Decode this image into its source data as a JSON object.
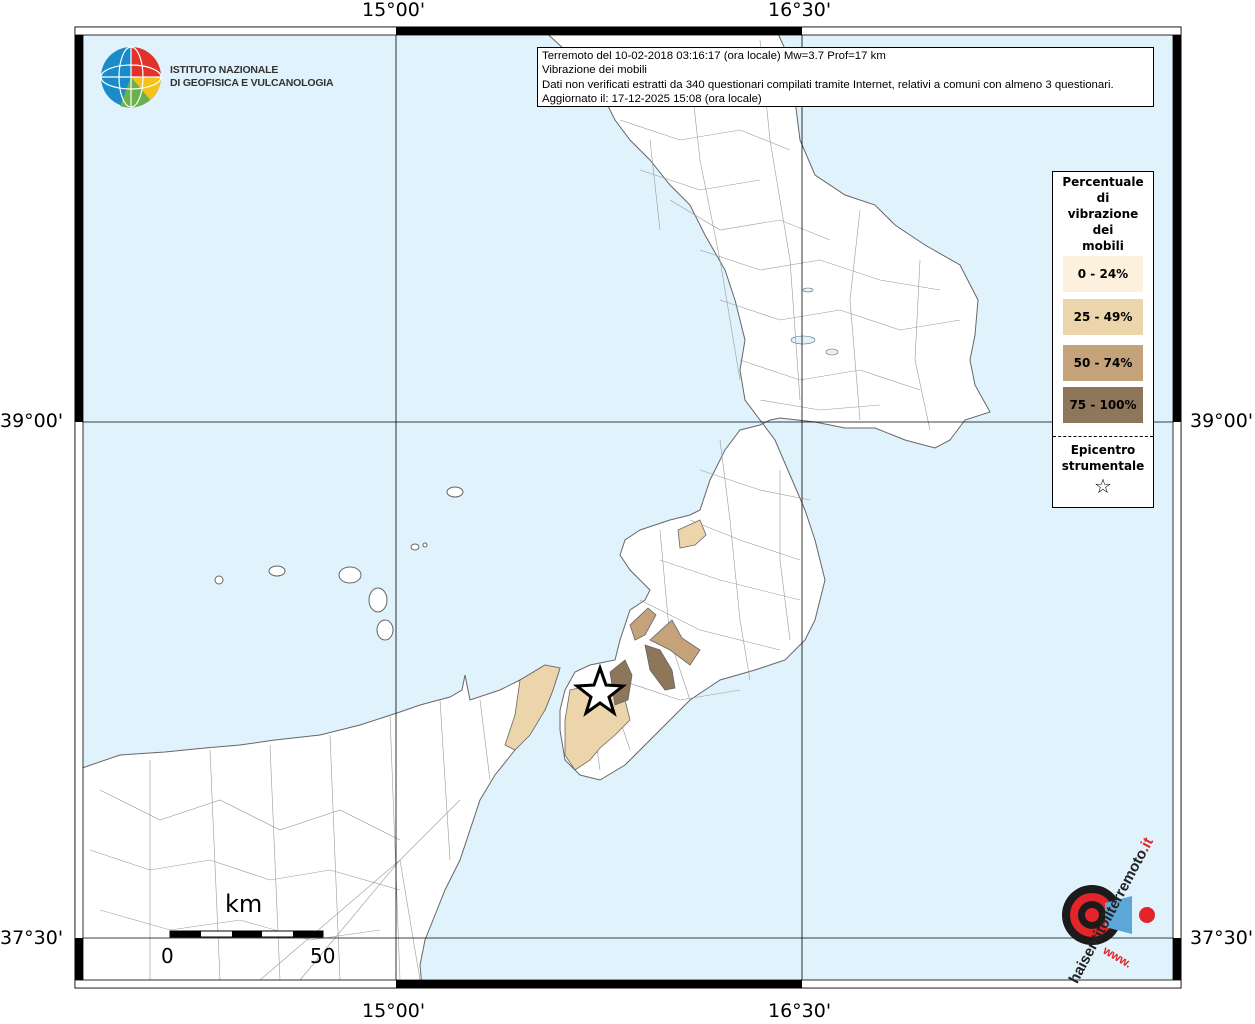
{
  "map": {
    "axes": {
      "lon_top_left": "15°00'",
      "lon_top_right": "16°30'",
      "lon_bottom_left": "15°00'",
      "lon_bottom_right": "16°30'",
      "lat_left_upper": "39°00'",
      "lat_left_lower": "37°30'",
      "lat_right_upper": "39°00'",
      "lat_right_lower": "37°30'"
    },
    "colors": {
      "sea": "#e0f2fc",
      "land": "#ffffff",
      "class_0_24": "#fdf0dc",
      "class_25_49": "#ecd5aa",
      "class_50_74": "#c4a27a",
      "class_75_100": "#8e765a"
    }
  },
  "logo": {
    "line1": "ISTITUTO NAZIONALE",
    "line2": "DI GEOFISICA E VULCANOLOGIA"
  },
  "info": {
    "line1": "Terremoto del 10-02-2018 03:16:17 (ora locale) Mw=3.7 Prof=17 km",
    "line2": "Vibrazione dei mobili",
    "line3": "Dati non verificati estratti da 340 questionari compilati tramite Internet, relativi a comuni con almeno 3 questionari.",
    "line4": "Aggiornato il: 17-12-2025 15:08 (ora locale)"
  },
  "legend": {
    "title_l1": "Percentuale",
    "title_l2": "di",
    "title_l3": "vibrazione",
    "title_l4": "dei",
    "title_l5": "mobili",
    "classes": [
      "0 - 24%",
      "25 - 49%",
      "50 - 74%",
      "75 - 100%"
    ],
    "epicenter_l1": "Epicentro",
    "epicenter_l2": "strumentale",
    "epicenter_symbol": "☆"
  },
  "scale": {
    "unit": "km",
    "start": "0",
    "end": "50"
  },
  "hst_logo": {
    "text_main": "haisentitoilterremoto",
    "text_suffix": ".it",
    "text_bottom": "www."
  }
}
